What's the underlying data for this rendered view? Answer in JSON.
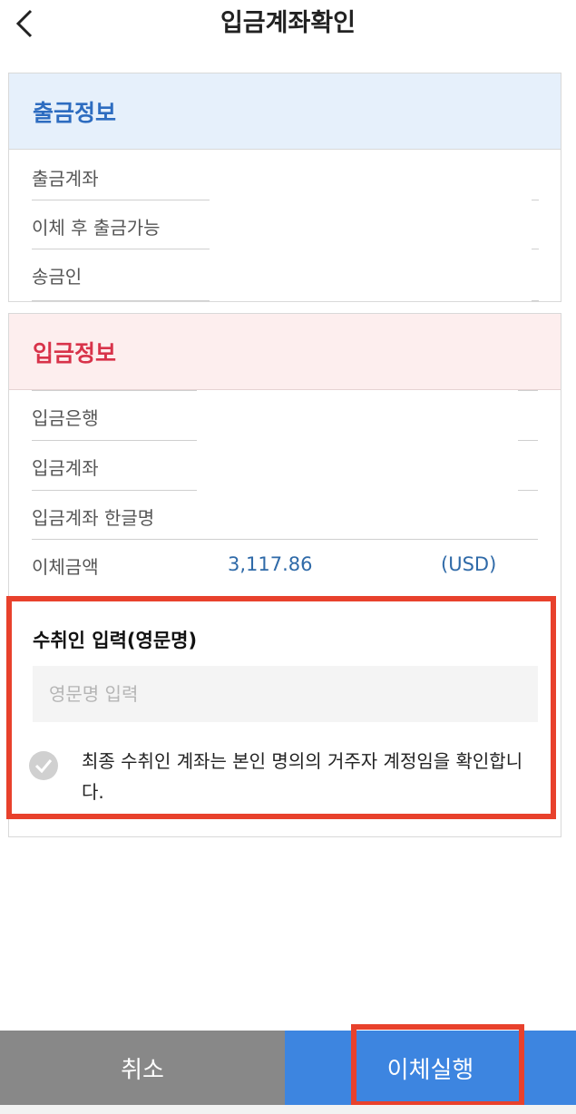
{
  "header": {
    "title": "입금계좌확인",
    "back_icon": "chevron-left-icon"
  },
  "withdraw": {
    "title": "출금정보",
    "rows": [
      "출금계좌",
      "이체 후 출금가능",
      "송금인"
    ]
  },
  "deposit": {
    "title": "입금정보",
    "rows": [
      "입금은행",
      "입금계좌",
      "입금계좌 한글명",
      "이체금액"
    ],
    "amount": "3,117.86",
    "currency": "(USD)"
  },
  "recipient": {
    "title": "수취인 입력(영문명)",
    "input_placeholder": "영문명 입력",
    "input_value": "",
    "confirm_text": "최종 수취인 계좌는 본인 명의의 거주자 계정임을 확인합니다."
  },
  "buttons": {
    "cancel": "취소",
    "execute": "이체실행"
  },
  "colors": {
    "withdraw_accent": "#2d6cc0",
    "deposit_accent": "#d8334a",
    "primary_button": "#3d85e0",
    "highlight": "#e8412c"
  }
}
